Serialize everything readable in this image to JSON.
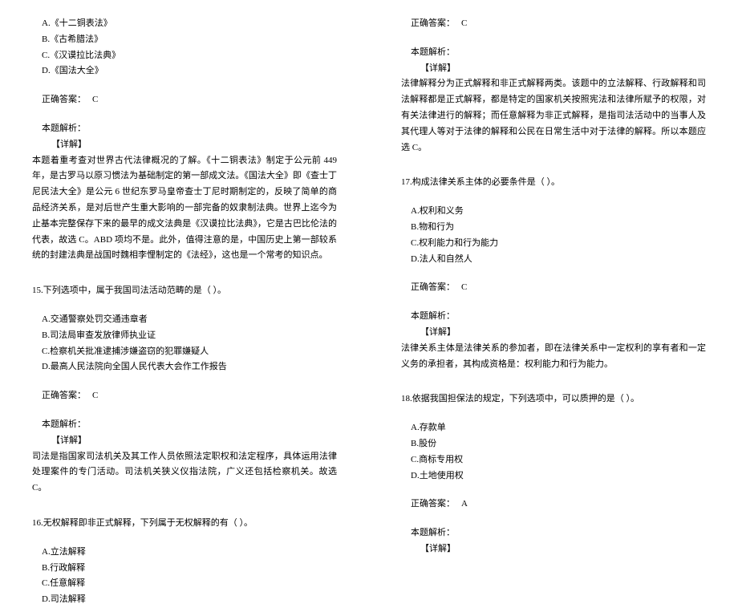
{
  "left_column": {
    "q_intro": {
      "options": [
        "A.《十二铜表法》",
        "B.《古希腊法》",
        "C.《汉谟拉比法典》",
        "D.《国法大全》"
      ],
      "answer_label": "正确答案：",
      "answer_value": "C",
      "analysis_label": "本题解析：",
      "detail_label": "【详解】",
      "explanation": "本题着重考查对世界古代法律概况的了解。《十二铜表法》制定于公元前 449 年，是古罗马以原习惯法为基础制定的第一部成文法。《国法大全》即《查士丁尼民法大全》是公元 6 世纪东罗马皇帝查士丁尼时期制定的，反映了简单的商品经济关系，是对后世产生重大影响的一部完备的奴隶制法典。世界上迄今为止基本完整保存下来的最早的成文法典是《汉谟拉比法典》，它是古巴比伦法的代表，故选 C。ABD 项均不是。此外，值得注意的是，中国历史上第一部较系统的封建法典是战国时魏相李悝制定的《法经》，这也是一个常考的知识点。"
    },
    "q15": {
      "title": "15.下列选项中，属于我国司法活动范畴的是（ ）。",
      "options": [
        "A.交通警察处罚交通违章者",
        "B.司法局审查发放律师执业证",
        "C.检察机关批准逮捕涉嫌盗窃的犯罪嫌疑人",
        "D.最高人民法院向全国人民代表大会作工作报告"
      ],
      "answer_label": "正确答案：",
      "answer_value": "C",
      "analysis_label": "本题解析：",
      "detail_label": "【详解】",
      "explanation": "司法是指国家司法机关及其工作人员依照法定职权和法定程序，具体运用法律处理案件的专门活动。司法机关狭义仪指法院，广义还包括检察机关。故选 C。"
    },
    "q16": {
      "title": "16.无权解释即非正式解释，下列属于无权解释的有（ ）。",
      "options": [
        "A.立法解释",
        "B.行政解释",
        "C.任意解释",
        "D.司法解释"
      ]
    }
  },
  "right_column": {
    "q16_answer": {
      "answer_label": "正确答案：",
      "answer_value": "C",
      "analysis_label": "本题解析：",
      "detail_label": "【详解】",
      "explanation": "法律解释分为正式解释和非正式解释两类。该题中的立法解释、行政解释和司法解释都是正式解释，都是特定的国家机关按照宪法和法律所赋予的权限，对有关法律进行的解释；而任意解释为非正式解释，是指司法活动中的当事人及其代理人等对于法律的解释和公民在日常生活中对于法律的解释。所以本题应选 C。"
    },
    "q17": {
      "title": "17.构成法律关系主体的必要条件是（ ）。",
      "options": [
        "A.权利和义务",
        "B.物和行为",
        "C.权利能力和行为能力",
        "D.法人和自然人"
      ],
      "answer_label": "正确答案：",
      "answer_value": "C",
      "analysis_label": "本题解析：",
      "detail_label": "【详解】",
      "explanation": "法律关系主体是法律关系的参加者，即在法律关系中一定权利的享有者和一定义务的承担者，其构成资格是：权利能力和行为能力。"
    },
    "q18": {
      "title": "18.依据我国担保法的规定，下列选项中，可以质押的是（  ）。",
      "options": [
        "A.存款单",
        "B.股份",
        "C.商标专用权",
        "D.土地使用权"
      ],
      "answer_label": "正确答案：",
      "answer_value": "A",
      "analysis_label": "本题解析：",
      "detail_label": "【详解】"
    }
  }
}
